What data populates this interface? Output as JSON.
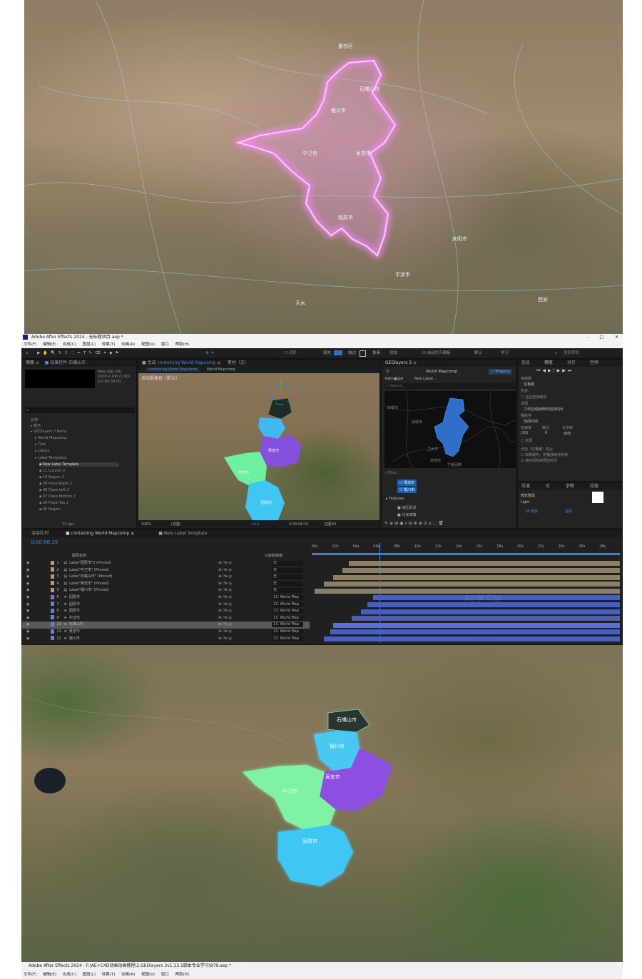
{
  "colors": {
    "glow": "#ff7cff",
    "cyan": "#3fc6f2",
    "purple": "#8c4fe0",
    "green": "#6ff0a0",
    "ae_accent": "#2d8ceb"
  },
  "top_map": {
    "labels": [
      "惠农区",
      "石嘴山市",
      "银川市",
      "吴忠市",
      "中卫市",
      "固原市",
      "天水",
      "平凉市",
      "庆阳市",
      "西安"
    ]
  },
  "ae": {
    "title": "Adobe After Effects 2024 - 无标题项目.aep *",
    "window_controls": [
      "-",
      "□",
      "✕"
    ],
    "menu": [
      "文件(F)",
      "编辑(E)",
      "合成(C)",
      "图层(L)",
      "效果(T)",
      "动画(A)",
      "视图(V)",
      "窗口",
      "帮助(H)"
    ],
    "toolbar": {
      "snap_label": "对齐",
      "fill_label": "填充",
      "stroke_label": "描边",
      "px_label": "像素",
      "add_label": "添加",
      "auto_open_label": "自动打开面板",
      "default_label": "默认",
      "learn_label": "学习",
      "search_placeholder": "搜索帮助"
    },
    "project": {
      "tab": "项目",
      "effects_tab": "效果控件 石嘴山市",
      "preview_name": "New Lab..ate",
      "preview_info": [
        "1000 x 200 (1.00)",
        "Δ 0:00:30:00, ..."
      ],
      "col_header": "名称",
      "items": [
        "颜色",
        "GEOlayers 3 Items",
        "World Mapcomp",
        "Tiles",
        "Labels",
        "Label Templates",
        "New Label Template",
        "11 Locator 2",
        "10 Region 2",
        "09 Place Right 2",
        "08 Place Left 2",
        "07 Place Bottom 2",
        "06 Place Top 2",
        "05 Region"
      ],
      "footer": "32 bpc"
    },
    "comp": {
      "tab_prefix": "合成",
      "tab_active": "containing World Mapcomp",
      "footage_tab": "素材（无）",
      "subtab_active": "containing World Mapcomp",
      "subtab2": "World Mapcomp",
      "camera": "活动摄像机（默认）",
      "region_labels": [
        "吴忠市",
        "中卫市",
        "固原市"
      ],
      "zoom": "100%",
      "quality": "(完整)",
      "timecode": "0:00:06:15",
      "offset": "+0.0",
      "render": "在图3D"
    },
    "geo": {
      "tab": "GEOlayers 3",
      "map_title": "World Mapcomp",
      "finalize": "Finalize",
      "new_label": "New Label ...",
      "search_placeholder": "Search...",
      "filter_placeholder": "Filter...",
      "map_labels": [
        "武威市",
        "白银市",
        "兰州市",
        "定西市",
        "宁夏回族"
      ],
      "layers": [
        "吴忠市",
        "银川市"
      ],
      "features_label": "Features",
      "features": [
        "城区街道",
        "马家滩镇"
      ]
    },
    "info": {
      "tabs": [
        "信息",
        "预览",
        "对齐",
        "音频"
      ],
      "shortcut_label": "快捷键",
      "shortcut_value": "空格键",
      "include_label": "包含：",
      "cache_label": "在回放前缓存",
      "range_label": "范围",
      "range_value": "工作区域延伸到当前时间",
      "play_from_label": "播放自",
      "play_from_value": "当前时间",
      "fps_label": "帧速率",
      "skip_label": "跳过",
      "res_label": "分辨率",
      "fps_value": "(30)",
      "skip_value": "0",
      "res_value": "自动",
      "fullscreen_label": "全屏",
      "click_stop_label": "点击（空格键）停止：",
      "cache_play_label": "如果缓存，则播放缓存的帧",
      "move_time_label": "将时间移到预览时间"
    },
    "char": {
      "tabs": [
        "段落",
        "库",
        "字符",
        "段落"
      ],
      "font": "微软雅黑",
      "style": "Light",
      "size": "18 像素",
      "size_auto": "自动"
    },
    "timeline": {
      "tabs": [
        "渲染队列",
        "containing World Mapcomp",
        "New Label Template"
      ],
      "timecode": "0:00:06:15",
      "col_name": "图层名称",
      "col_parent": "父级和链接",
      "ruler": [
        "00s",
        "02s",
        "04s",
        "06s",
        "08s",
        "10s",
        "12s",
        "14s",
        "16s",
        "18s",
        "20s",
        "22s",
        "24s",
        "26s",
        "28s"
      ],
      "layers": [
        {
          "num": "1",
          "name": "Label\"固原市\"2 (Pinned)",
          "parent": "无",
          "color": "#b89870",
          "bar_start": 0.12
        },
        {
          "num": "2",
          "name": "Label\"中卫市\" (Pinned)",
          "parent": "无",
          "color": "#b89870",
          "bar_start": 0.1
        },
        {
          "num": "3",
          "name": "Label\"石嘴山市\" (Pinned)",
          "parent": "无",
          "color": "#b89870",
          "bar_start": 0.07
        },
        {
          "num": "4",
          "name": "Label\"吴忠市\" (Pinned)",
          "parent": "无",
          "color": "#b89870",
          "bar_start": 0.04
        },
        {
          "num": "5",
          "name": "Label\"银川市\" (Pinned)",
          "parent": "无",
          "color": "#b89870",
          "bar_start": 0.01
        },
        {
          "num": "6",
          "name": "固原市",
          "parent": "13. World Map",
          "color": "#6b7cd8",
          "bar_start": 0.2
        },
        {
          "num": "7",
          "name": "固原市",
          "parent": "13. World Map",
          "color": "#6b7cd8",
          "bar_start": 0.18
        },
        {
          "num": "8",
          "name": "固原市",
          "parent": "13. World Map",
          "color": "#6b7cd8",
          "bar_start": 0.16
        },
        {
          "num": "9",
          "name": "中卫市",
          "parent": "13. World Map",
          "color": "#6b7cd8",
          "bar_start": 0.13
        },
        {
          "num": "10",
          "name": "石嘴山市",
          "parent": "13. World Map",
          "color": "#6b7cd8",
          "bar_start": 0.07
        },
        {
          "num": "11",
          "name": "吴忠市",
          "parent": "13. World Map",
          "color": "#6b7cd8",
          "bar_start": 0.06
        },
        {
          "num": "12",
          "name": "银川市",
          "parent": "13. World Map",
          "color": "#6b7cd8",
          "bar_start": 0.04
        }
      ],
      "selected_index": 9,
      "playhead": 0.22,
      "watermark": "AE学习站"
    }
  },
  "bottom_map": {
    "region_labels": [
      "石嘴山市",
      "银川市",
      "吴忠市",
      "中卫市",
      "固原市"
    ]
  },
  "taskbar": {
    "title": "Adobe After Effects 2024 - F:\\AE+C4D动画动画教程\\2.GEOlayers 3v1.13.1脚本专业学习\\879.aep *",
    "menu": [
      "文件(F)",
      "编辑(E)",
      "合成(C)",
      "图层(L)",
      "效果(T)",
      "动画(A)",
      "视图(V)",
      "窗口",
      "帮助(H)"
    ]
  }
}
